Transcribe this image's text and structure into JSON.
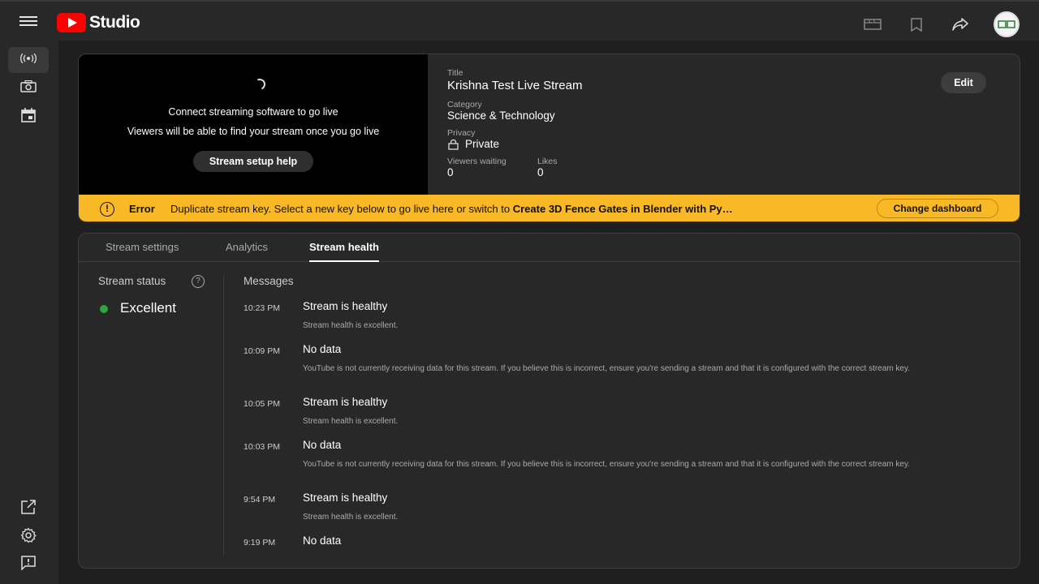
{
  "app": {
    "name": "Studio"
  },
  "topbar": {
    "icons": [
      "clapperboard-icon",
      "bookmark-icon",
      "share-icon",
      "account-avatar"
    ]
  },
  "sidebar": {
    "items": [
      {
        "icon": "live-broadcast-icon",
        "active": true
      },
      {
        "icon": "camera-icon",
        "active": false
      },
      {
        "icon": "calendar-icon",
        "active": false
      },
      {
        "icon": "open-external-icon",
        "active": false
      },
      {
        "icon": "settings-icon",
        "active": false
      },
      {
        "icon": "feedback-icon",
        "active": false
      }
    ]
  },
  "preview": {
    "line1": "Connect streaming software to go live",
    "line2": "Viewers will be able to find your stream once you go live",
    "setup_button": "Stream setup help"
  },
  "details": {
    "title_label": "Title",
    "title": "Krishna Test Live Stream",
    "category_label": "Category",
    "category": "Science & Technology",
    "privacy_label": "Privacy",
    "privacy": "Private",
    "viewers_label": "Viewers waiting",
    "viewers": "0",
    "likes_label": "Likes",
    "likes": "0",
    "edit_button": "Edit"
  },
  "error_bar": {
    "label": "Error",
    "message": "Duplicate stream key. Select a new key below to go live here or switch to ",
    "message_link": "Create 3D Fence Gates in Blender with Py…",
    "change_button": "Change dashboard",
    "color": "#f9b825"
  },
  "tabs": [
    {
      "label": "Stream settings",
      "active": false
    },
    {
      "label": "Analytics",
      "active": false
    },
    {
      "label": "Stream health",
      "active": true
    }
  ],
  "stream_status": {
    "title": "Stream status",
    "value": "Excellent",
    "status_color": "#2ba640"
  },
  "messages": {
    "title": "Messages",
    "items": [
      {
        "time": "10:23 PM",
        "title": "Stream is healthy",
        "desc": "Stream health is excellent."
      },
      {
        "time": "10:09 PM",
        "title": "No data",
        "desc": "YouTube is not currently receiving data for this stream. If you believe this is incorrect, ensure you're sending a stream and that it is configured with the correct stream key."
      },
      {
        "time": "10:05 PM",
        "title": "Stream is healthy",
        "desc": "Stream health is excellent."
      },
      {
        "time": "10:03 PM",
        "title": "No data",
        "desc": "YouTube is not currently receiving data for this stream. If you believe this is incorrect, ensure you're sending a stream and that it is configured with the correct stream key."
      },
      {
        "time": "9:54 PM",
        "title": "Stream is healthy",
        "desc": "Stream health is excellent."
      },
      {
        "time": "9:19 PM",
        "title": "No data",
        "desc": ""
      }
    ]
  }
}
